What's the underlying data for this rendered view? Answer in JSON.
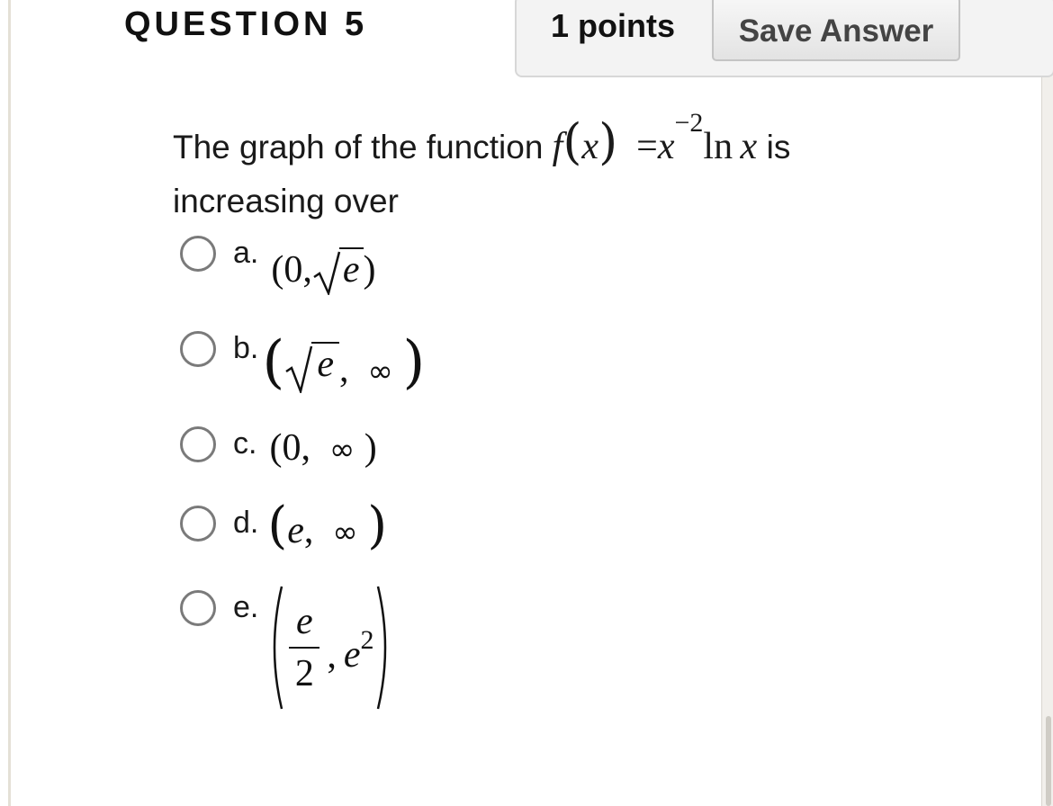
{
  "question": {
    "title": "QUESTION 5",
    "points": "1 points",
    "save_label": "Save Answer",
    "text_before": "The graph of the function",
    "text_after": "is",
    "text_line2": "increasing over",
    "function": {
      "name": "f",
      "var": "x",
      "eq": "=",
      "base": "x",
      "exponent": "−2",
      "ln": "ln",
      "arg": "x"
    }
  },
  "options": [
    {
      "letter": "a.",
      "answer": "(0,√e)"
    },
    {
      "letter": "b.",
      "answer": "(√e, ∞)"
    },
    {
      "letter": "c.",
      "answer": "(0, ∞)"
    },
    {
      "letter": "d.",
      "answer": "(e, ∞)"
    },
    {
      "letter": "e.",
      "answer": "(e/2, e^2)"
    }
  ],
  "math_glyphs": {
    "zero": "0",
    "e": "e",
    "comma": ",",
    "infinity": "∞",
    "two": "2",
    "lparen": "(",
    "rparen": ")"
  }
}
